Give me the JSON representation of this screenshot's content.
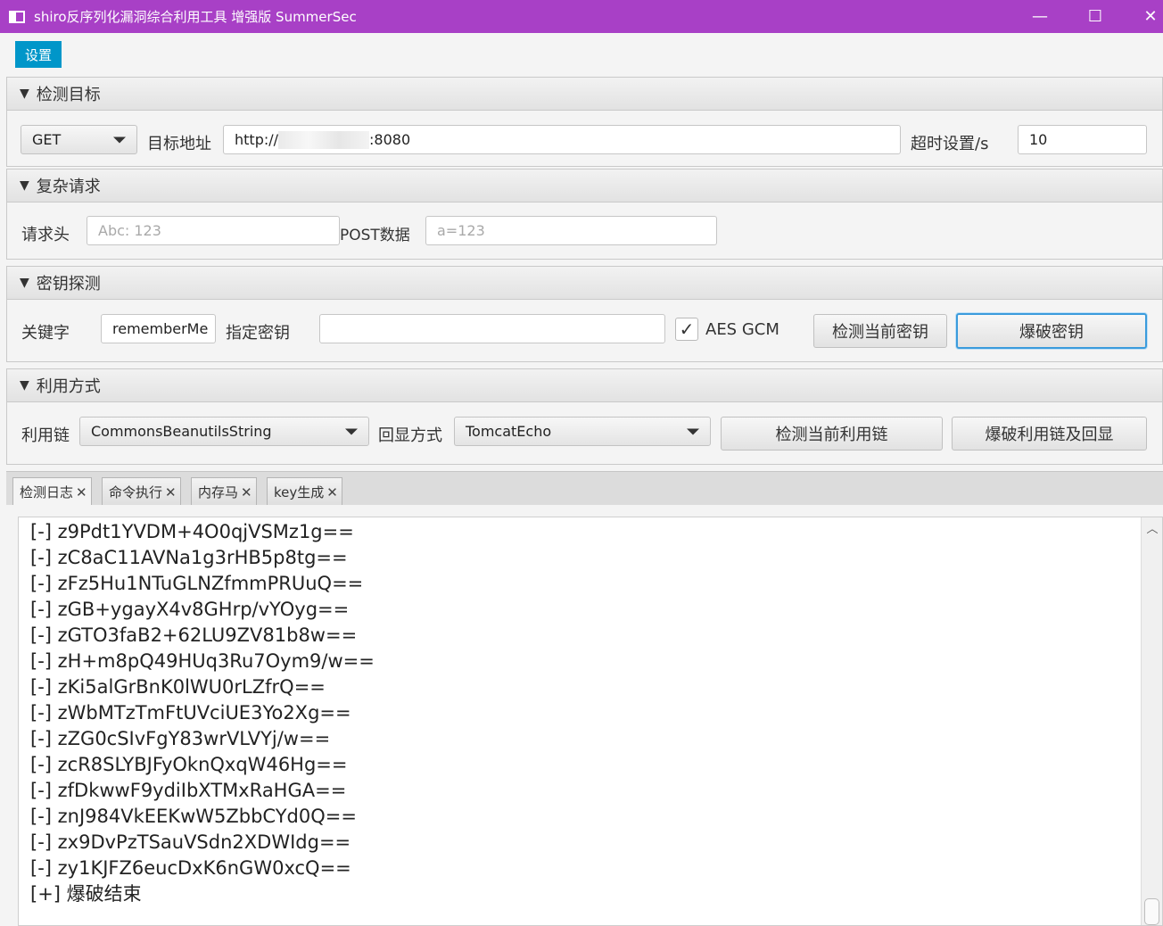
{
  "window": {
    "title": "shiro反序列化漏洞综合利用工具 增强版 SummerSec",
    "minimize": "—",
    "maximize": "☐",
    "close": "✕"
  },
  "menu": {
    "settings": "设置"
  },
  "target": {
    "header": "检测目标",
    "method": "GET",
    "url_label": "目标地址",
    "url_prefix": "http://",
    "url_suffix": ":8080",
    "timeout_label": "超时设置/s",
    "timeout_value": "10"
  },
  "complex": {
    "header": "复杂请求",
    "headers_label": "请求头",
    "headers_placeholder": "Abc: 123",
    "post_label": "POST数据",
    "post_placeholder": "a=123"
  },
  "key": {
    "header": "密钥探测",
    "keyword_label": "关键字",
    "keyword_value": "rememberMe",
    "specified_label": "指定密钥",
    "specified_value": "",
    "aes_gcm_label": "AES GCM",
    "aes_gcm_checked": true,
    "check_button": "检测当前密钥",
    "brute_button": "爆破密钥"
  },
  "exploit": {
    "header": "利用方式",
    "chain_label": "利用链",
    "chain_value": "CommonsBeanutilsString",
    "echo_label": "回显方式",
    "echo_value": "TomcatEcho",
    "check_button": "检测当前利用链",
    "brute_button": "爆破利用链及回显"
  },
  "tabs": [
    {
      "label": "检测日志",
      "close": "✕"
    },
    {
      "label": "命令执行",
      "close": "✕"
    },
    {
      "label": "内存马",
      "close": "✕"
    },
    {
      "label": "key生成",
      "close": "✕"
    }
  ],
  "log_lines": [
    "[-] z9Pdt1YVDM+4O0qjVSMz1g==",
    "[-] zC8aC11AVNa1g3rHB5p8tg==",
    "[-] zFz5Hu1NTuGLNZfmmPRUuQ==",
    "[-] zGB+ygayX4v8GHrp/vYOyg==",
    "[-] zGTO3faB2+62LU9ZV81b8w==",
    "[-] zH+m8pQ49HUq3Ru7Oym9/w==",
    "[-] zKi5alGrBnK0lWU0rLZfrQ==",
    "[-] zWbMTzTmFtUVciUE3Yo2Xg==",
    "[-] zZG0cSIvFgY83wrVLVYj/w==",
    "[-] zcR8SLYBJFyOknQxqW46Hg==",
    "[-] zfDkwwF9ydiIbXTMxRaHGA==",
    "[-] znJ984VkEEKwW5ZbbCYd0Q==",
    "[-] zx9DvPzTSauVSdn2XDWIdg==",
    "[-] zy1KJFZ6eucDxK6nGW0xcQ==",
    "[+] 爆破结束"
  ]
}
